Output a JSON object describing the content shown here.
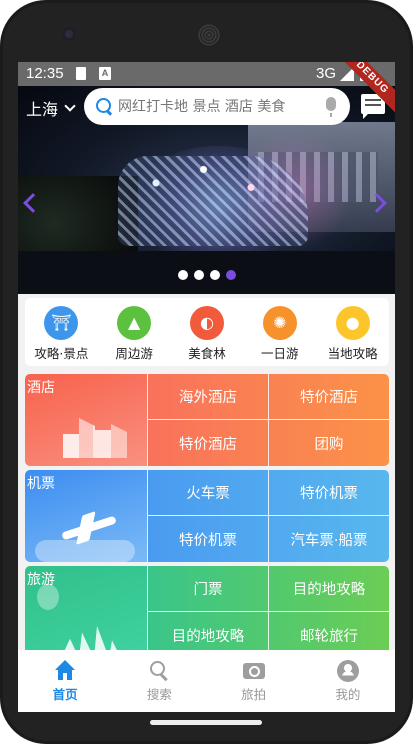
{
  "status_bar": {
    "time": "12:35",
    "network": "3G",
    "debug_banner": "DEBUG"
  },
  "header": {
    "city": "上海",
    "search_placeholder": "网红打卡地 景点 酒店 美食"
  },
  "banner": {
    "page_count": 4,
    "active_index": 3
  },
  "categories": [
    {
      "label": "攻略·景点",
      "icon": "attraction-icon",
      "color": "#3d96ec"
    },
    {
      "label": "周边游",
      "icon": "mountain-icon",
      "color": "#5cc13f"
    },
    {
      "label": "美食林",
      "icon": "food-icon",
      "color": "#f25a3c"
    },
    {
      "label": "一日游",
      "icon": "day-trip-icon",
      "color": "#f7912c"
    },
    {
      "label": "当地攻略",
      "icon": "location-pin-icon",
      "color": "#fcc52a"
    }
  ],
  "grid": {
    "hotel": {
      "title": "酒店",
      "items": [
        "海外酒店",
        "特价酒店",
        "特价酒店",
        "团购"
      ]
    },
    "flight": {
      "title": "机票",
      "items": [
        "火车票",
        "特价机票",
        "特价机票",
        "汽车票·船票"
      ]
    },
    "travel": {
      "title": "旅游",
      "items": [
        "门票",
        "目的地攻略",
        "目的地攻略",
        "邮轮旅行"
      ]
    }
  },
  "bottom_nav": [
    {
      "label": "首页",
      "icon": "home-icon",
      "active": true
    },
    {
      "label": "搜索",
      "icon": "search-icon",
      "active": false
    },
    {
      "label": "旅拍",
      "icon": "camera-icon",
      "active": false
    },
    {
      "label": "我的",
      "icon": "profile-icon",
      "active": false
    }
  ],
  "colors": {
    "accent": "#1e88e5",
    "indicator": "#7b4ce0"
  }
}
